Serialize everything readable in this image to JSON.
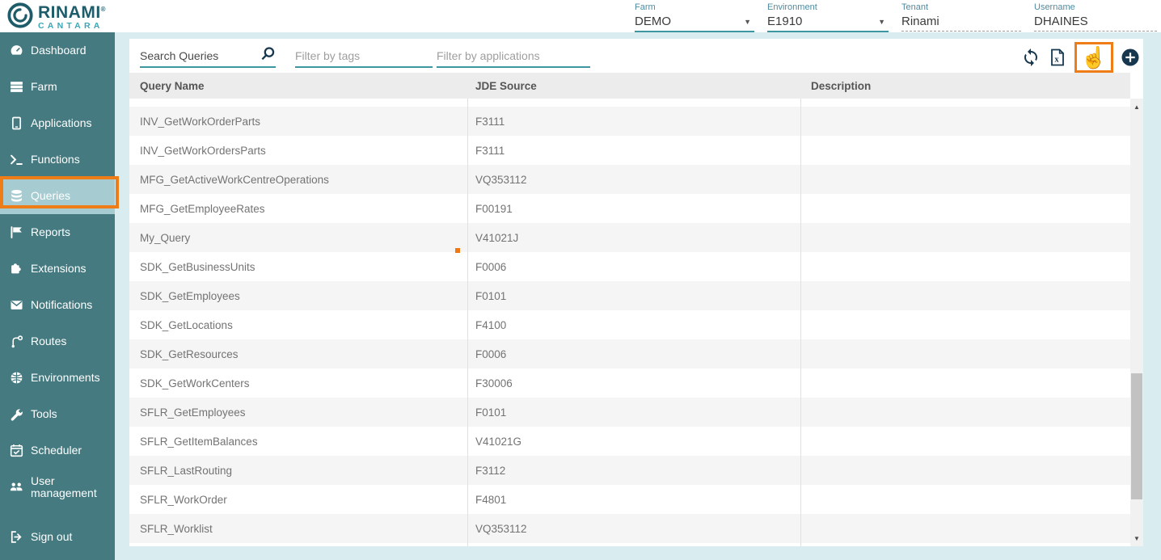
{
  "header": {
    "logo": {
      "title": "RINAMI",
      "registered": "®",
      "subtitle": "CANTARA"
    },
    "fields": [
      {
        "id": "farm",
        "label": "Farm",
        "value": "DEMO",
        "type": "select"
      },
      {
        "id": "environment",
        "label": "Environment",
        "value": "E1910",
        "type": "select"
      },
      {
        "id": "tenant",
        "label": "Tenant",
        "value": "Rinami",
        "type": "plain"
      },
      {
        "id": "username",
        "label": "Username",
        "value": "DHAINES",
        "type": "plain"
      }
    ]
  },
  "sidebar": {
    "items": [
      {
        "id": "dashboard",
        "label": "Dashboard",
        "icon": "dashboard-icon",
        "selected": false
      },
      {
        "id": "farm",
        "label": "Farm",
        "icon": "farm-icon",
        "selected": false
      },
      {
        "id": "applications",
        "label": "Applications",
        "icon": "applications-icon",
        "selected": false
      },
      {
        "id": "functions",
        "label": "Functions",
        "icon": "functions-icon",
        "selected": false
      },
      {
        "id": "queries",
        "label": "Queries",
        "icon": "queries-icon",
        "selected": true
      },
      {
        "id": "reports",
        "label": "Reports",
        "icon": "reports-icon",
        "selected": false
      },
      {
        "id": "extensions",
        "label": "Extensions",
        "icon": "extensions-icon",
        "selected": false
      },
      {
        "id": "notifications",
        "label": "Notifications",
        "icon": "notifications-icon",
        "selected": false
      },
      {
        "id": "routes",
        "label": "Routes",
        "icon": "routes-icon",
        "selected": false
      },
      {
        "id": "environments",
        "label": "Environments",
        "icon": "environments-icon",
        "selected": false
      },
      {
        "id": "tools",
        "label": "Tools",
        "icon": "tools-icon",
        "selected": false
      },
      {
        "id": "scheduler",
        "label": "Scheduler",
        "icon": "scheduler-icon",
        "selected": false
      },
      {
        "id": "user-management",
        "label": "User management",
        "icon": "user-management-icon",
        "selected": false
      },
      {
        "id": "sign-out",
        "label": "Sign out",
        "icon": "sign-out-icon",
        "selected": false
      }
    ]
  },
  "toolbar": {
    "search": {
      "value": "Search Queries"
    },
    "filters": [
      {
        "placeholder": "Filter by tags"
      },
      {
        "placeholder": "Filter by applications"
      }
    ],
    "actions": [
      {
        "id": "refresh",
        "icon": "refresh-icon",
        "annotated": false
      },
      {
        "id": "excel-export",
        "icon": "excel-icon",
        "annotated": false
      },
      {
        "id": "hand-tool",
        "icon": "hand-icon",
        "annotated": true
      },
      {
        "id": "add-query",
        "icon": "add-icon",
        "annotated": false
      }
    ]
  },
  "table": {
    "columns": [
      "Query Name",
      "JDE Source",
      "Description"
    ],
    "rows": [
      {
        "name": "INV_GetWorkOrderParts",
        "source": "F3111",
        "description": ""
      },
      {
        "name": "INV_GetWorkOrdersParts",
        "source": "F3111",
        "description": ""
      },
      {
        "name": "MFG_GetActiveWorkCentreOperations",
        "source": "VQ353112",
        "description": ""
      },
      {
        "name": "MFG_GetEmployeeRates",
        "source": "F00191",
        "description": ""
      },
      {
        "name": "My_Query",
        "source": "V41021J",
        "description": ""
      },
      {
        "name": "SDK_GetBusinessUnits",
        "source": "F0006",
        "description": ""
      },
      {
        "name": "SDK_GetEmployees",
        "source": "F0101",
        "description": ""
      },
      {
        "name": "SDK_GetLocations",
        "source": "F4100",
        "description": ""
      },
      {
        "name": "SDK_GetResources",
        "source": "F0006",
        "description": ""
      },
      {
        "name": "SDK_GetWorkCenters",
        "source": "F30006",
        "description": ""
      },
      {
        "name": "SFLR_GetEmployees",
        "source": "F0101",
        "description": ""
      },
      {
        "name": "SFLR_GetItemBalances",
        "source": "V41021G",
        "description": ""
      },
      {
        "name": "SFLR_LastRouting",
        "source": "F3112",
        "description": ""
      },
      {
        "name": "SFLR_WorkOrder",
        "source": "F4801",
        "description": ""
      },
      {
        "name": "SFLR_Worklist",
        "source": "VQ353112",
        "description": ""
      }
    ]
  },
  "scrollbar": {
    "up_glyph": "▲",
    "down_glyph": "▼"
  },
  "annotations": {
    "highlight_color": "#ee7d17",
    "targets": [
      "sidebar-item-queries",
      "hand-tool-button",
      "row-marker-dot"
    ]
  },
  "colors": {
    "accent_teal": "#3e96a1",
    "sidebar_teal": "#447a80",
    "selected_item": "#a6ccd1",
    "main_background": "#d9edf0",
    "icon_navy": "#17374e",
    "header_row": "#ececec",
    "row_alt": "#f5f5f5",
    "annotation_orange": "#ee7d17",
    "logo_dark": "#1d5c68",
    "logo_light": "#3aa7b5"
  }
}
